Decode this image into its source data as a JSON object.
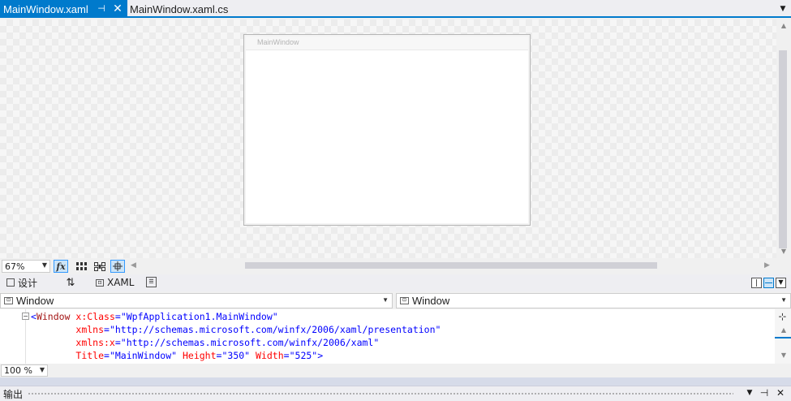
{
  "tabs": [
    {
      "label": "MainWindow.xaml",
      "active": true,
      "pin_glyph": "⊣",
      "close_glyph": "✕"
    },
    {
      "label": "MainWindow.xaml.cs",
      "active": false
    }
  ],
  "tab_overflow_glyph": "▼",
  "designer": {
    "window_title": "MainWindow",
    "zoom": "67%"
  },
  "split_toolbar": {
    "design_tab": "设计",
    "swap_glyph": "⇅",
    "xaml_tab": "XAML"
  },
  "selectors": {
    "element_type": "Window",
    "element_member": "Window"
  },
  "code": {
    "lines": [
      [
        {
          "t": "<",
          "c": "punct"
        },
        {
          "t": "Window",
          "c": "tag"
        },
        {
          "t": " ",
          "c": "plain"
        },
        {
          "t": "x:Class",
          "c": "attr"
        },
        {
          "t": "=",
          "c": "punct"
        },
        {
          "t": "\"WpfApplication1.MainWindow\"",
          "c": "val"
        }
      ],
      [
        {
          "t": "        ",
          "c": "plain"
        },
        {
          "t": "xmlns",
          "c": "attr"
        },
        {
          "t": "=",
          "c": "punct"
        },
        {
          "t": "\"http://schemas.microsoft.com/winfx/2006/xaml/presentation\"",
          "c": "val"
        }
      ],
      [
        {
          "t": "        ",
          "c": "plain"
        },
        {
          "t": "xmlns:x",
          "c": "attr"
        },
        {
          "t": "=",
          "c": "punct"
        },
        {
          "t": "\"http://schemas.microsoft.com/winfx/2006/xaml\"",
          "c": "val"
        }
      ],
      [
        {
          "t": "        ",
          "c": "plain"
        },
        {
          "t": "Title",
          "c": "attr"
        },
        {
          "t": "=",
          "c": "punct"
        },
        {
          "t": "\"MainWindow\"",
          "c": "val"
        },
        {
          "t": " ",
          "c": "plain"
        },
        {
          "t": "Height",
          "c": "attr"
        },
        {
          "t": "=",
          "c": "punct"
        },
        {
          "t": "\"350\"",
          "c": "val"
        },
        {
          "t": " ",
          "c": "plain"
        },
        {
          "t": "Width",
          "c": "attr"
        },
        {
          "t": "=",
          "c": "punct"
        },
        {
          "t": "\"525\"",
          "c": "val"
        },
        {
          "t": ">",
          "c": "punct"
        }
      ]
    ],
    "fold_glyph": "−",
    "zoom": "100 %"
  },
  "output": {
    "title": "输出",
    "dropdown_glyph": "▼",
    "pin_glyph": "⊣",
    "close_glyph": "✕"
  },
  "colors": {
    "accent": "#007acc",
    "xml_tag": "#a31515",
    "xml_attribute": "#ff0000",
    "xml_value": "#0000ff"
  },
  "icons": {
    "fx": "fx-icon",
    "grid": "grid-icon",
    "snap_grid": "snap-to-grid-icon",
    "snaplines": "snaplines-icon"
  }
}
